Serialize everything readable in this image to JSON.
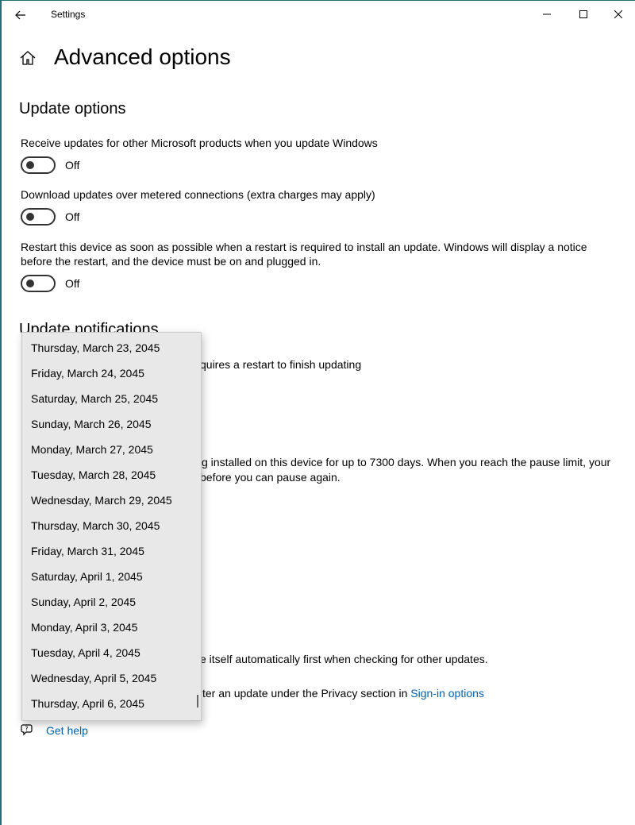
{
  "window": {
    "title": "Settings"
  },
  "page": {
    "title": "Advanced options"
  },
  "update_options": {
    "heading": "Update options",
    "items": [
      {
        "label": "Receive updates for other Microsoft products when you update Windows",
        "state": "Off"
      },
      {
        "label": "Download updates over metered connections (extra charges may apply)",
        "state": "Off"
      },
      {
        "label": "Restart this device as soon as possible when a restart is required to install an update. Windows will display a notice before the restart, and the device must be on and plugged in.",
        "state": "Off"
      }
    ]
  },
  "update_notifications": {
    "heading": "Update notifications",
    "partial_text": "quires a restart to finish updating"
  },
  "pause": {
    "partial_line1": "g installed on this device for up to 7300 days. When you reach the pause limit, your",
    "partial_line2": "before you can pause again."
  },
  "partial_text_1": "e itself automatically first when checking for other updates.",
  "privacy": {
    "partial_text": "ter an update under the Privacy section in ",
    "link": "Sign-in options"
  },
  "dropdown": {
    "items": [
      "Thursday, March 23, 2045",
      "Friday, March 24, 2045",
      "Saturday, March 25, 2045",
      "Sunday, March 26, 2045",
      "Monday, March 27, 2045",
      "Tuesday, March 28, 2045",
      "Wednesday, March 29, 2045",
      "Thursday, March 30, 2045",
      "Friday, March 31, 2045",
      "Saturday, April 1, 2045",
      "Sunday, April 2, 2045",
      "Monday, April 3, 2045",
      "Tuesday, April 4, 2045",
      "Wednesday, April 5, 2045",
      "Thursday, April 6, 2045"
    ]
  },
  "help": {
    "label": "Get help"
  }
}
